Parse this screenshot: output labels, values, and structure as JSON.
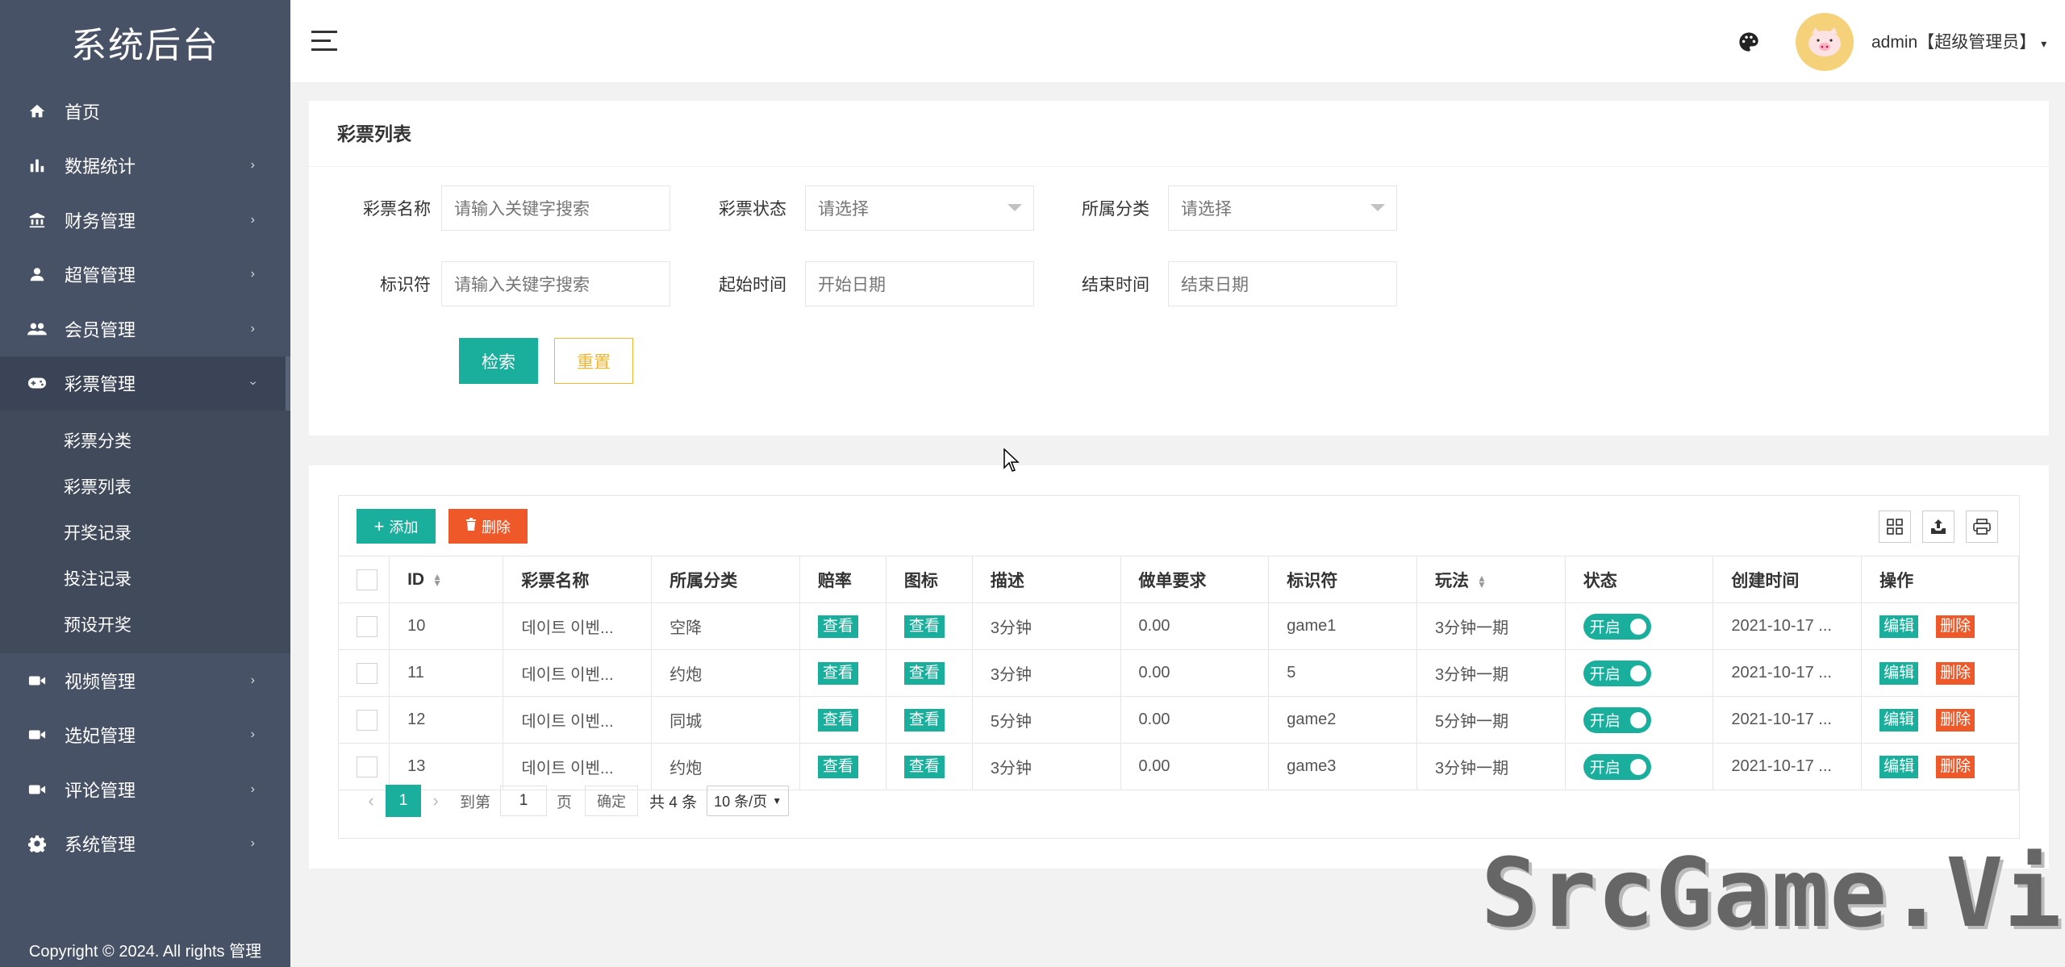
{
  "sidebar": {
    "logo": "系统后台",
    "items": [
      {
        "label": "首页",
        "icon": "home-icon",
        "arrow": ""
      },
      {
        "label": "数据统计",
        "icon": "bar-chart-icon",
        "arrow": "›"
      },
      {
        "label": "财务管理",
        "icon": "bank-icon",
        "arrow": "›"
      },
      {
        "label": "超管管理",
        "icon": "user-icon",
        "arrow": "›"
      },
      {
        "label": "会员管理",
        "icon": "users-icon",
        "arrow": "›"
      },
      {
        "label": "彩票管理",
        "icon": "gamepad-icon",
        "arrow": "›"
      }
    ],
    "sub_items": [
      "彩票分类",
      "彩票列表",
      "开奖记录",
      "投注记录",
      "预设开奖"
    ],
    "items_after": [
      {
        "label": "视频管理",
        "icon": "video-icon",
        "arrow": "›"
      },
      {
        "label": "选妃管理",
        "icon": "video-icon",
        "arrow": "›"
      },
      {
        "label": "评论管理",
        "icon": "video-icon",
        "arrow": "›"
      },
      {
        "label": "系统管理",
        "icon": "gear-icon",
        "arrow": "›"
      }
    ],
    "copyright": "Copyright © 2024. All rights 管理"
  },
  "header": {
    "user": "admin【超级管理员】",
    "caret": "▾"
  },
  "search": {
    "title": "彩票列表",
    "name_label": "彩票名称",
    "name_placeholder": "请输入关键字搜索",
    "status_label": "彩票状态",
    "status_placeholder": "请选择",
    "category_label": "所属分类",
    "category_placeholder": "请选择",
    "key_label": "标识符",
    "key_placeholder": "请输入关键字搜索",
    "start_label": "起始时间",
    "start_placeholder": "开始日期",
    "end_label": "结束时间",
    "end_placeholder": "结束日期",
    "search_btn": "检索",
    "reset_btn": "重置"
  },
  "table": {
    "add_btn": "添加",
    "delete_btn": "删除",
    "columns": [
      "ID",
      "彩票名称",
      "所属分类",
      "赔率",
      "图标",
      "描述",
      "做单要求",
      "标识符",
      "玩法",
      "状态",
      "创建时间",
      "操作"
    ],
    "rows": [
      {
        "id": "10",
        "name": "데이트 이벤...",
        "category": "空降",
        "odds": "查看",
        "icon": "查看",
        "desc": "3分钟",
        "req": "0.00",
        "key": "game1",
        "play": "3分钟一期",
        "status": "开启",
        "created": "2021-10-17 ...",
        "edit": "编辑",
        "remove": "删除"
      },
      {
        "id": "11",
        "name": "데이트 이벤...",
        "category": "约炮",
        "odds": "查看",
        "icon": "查看",
        "desc": "3分钟",
        "req": "0.00",
        "key": "5",
        "play": "3分钟一期",
        "status": "开启",
        "created": "2021-10-17 ...",
        "edit": "编辑",
        "remove": "删除"
      },
      {
        "id": "12",
        "name": "데이트 이벤...",
        "category": "同城",
        "odds": "查看",
        "icon": "查看",
        "desc": "5分钟",
        "req": "0.00",
        "key": "game2",
        "play": "5分钟一期",
        "status": "开启",
        "created": "2021-10-17 ...",
        "edit": "编辑",
        "remove": "删除"
      },
      {
        "id": "13",
        "name": "데이트 이벤...",
        "category": "约炮",
        "odds": "查看",
        "icon": "查看",
        "desc": "3分钟",
        "req": "0.00",
        "key": "game3",
        "play": "3分钟一期",
        "status": "开启",
        "created": "2021-10-17 ...",
        "edit": "编辑",
        "remove": "删除"
      }
    ]
  },
  "pager": {
    "prev": "‹",
    "current": "1",
    "next": "›",
    "goto_label": "到第",
    "goto_value": "1",
    "page_unit": "页",
    "confirm": "确定",
    "total": "共 4 条",
    "page_size": "10 条/页"
  },
  "watermark": "SrcGame.Vip",
  "colors": {
    "primary": "#1aaf9d",
    "danger": "#ef5828",
    "warning": "#f1b52e",
    "sidebar_bg": "#475266"
  }
}
